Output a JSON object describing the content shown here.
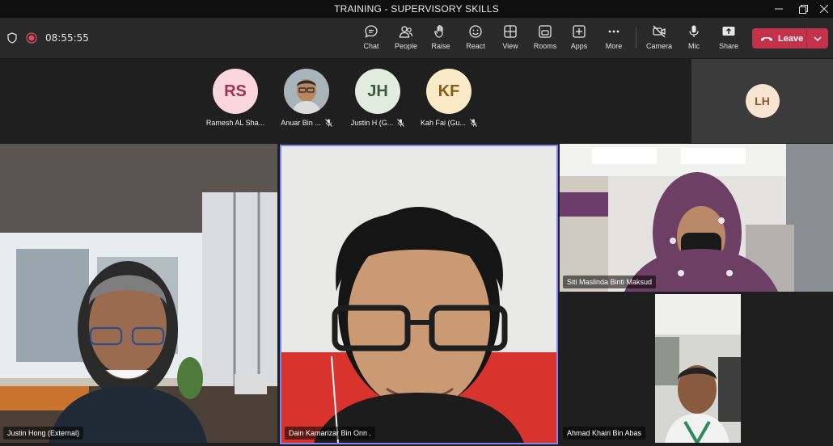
{
  "window": {
    "title": "TRAINING - SUPERVISORY SKILLS"
  },
  "toolbar": {
    "timer": "08:55:55",
    "buttons": [
      {
        "label": "Chat",
        "icon": "chat-icon"
      },
      {
        "label": "People",
        "icon": "people-icon"
      },
      {
        "label": "Raise",
        "icon": "raise-hand-icon"
      },
      {
        "label": "React",
        "icon": "react-icon"
      },
      {
        "label": "View",
        "icon": "view-icon"
      },
      {
        "label": "Rooms",
        "icon": "rooms-icon"
      },
      {
        "label": "Apps",
        "icon": "apps-icon"
      },
      {
        "label": "More",
        "icon": "more-icon"
      },
      {
        "label": "Camera",
        "icon": "camera-off-icon"
      },
      {
        "label": "Mic",
        "icon": "mic-icon"
      },
      {
        "label": "Share",
        "icon": "share-icon"
      }
    ],
    "leave_label": "Leave"
  },
  "strip": {
    "participants": [
      {
        "initials": "RS",
        "name": "Ramesh AL Sha...",
        "bg": "#f9d6dd",
        "fg": "#a0344b",
        "muted": false,
        "photo": false
      },
      {
        "initials": "",
        "name": "Anuar Bin ...",
        "bg": "#8a8a8a",
        "fg": "#ffffff",
        "muted": true,
        "photo": true
      },
      {
        "initials": "JH",
        "name": "Justin H (G...",
        "bg": "#e3ece1",
        "fg": "#3f5a3c",
        "muted": true,
        "photo": false
      },
      {
        "initials": "KF",
        "name": "Kah Fai (Gu...",
        "bg": "#fbeac8",
        "fg": "#8a5a12",
        "muted": true,
        "photo": false
      }
    ],
    "self_initials": "LH"
  },
  "tiles": {
    "justin": "Justin Hong (External)",
    "dain": "Dain Kamarizar Bin Onn .",
    "siti": "Siti Maslinda Binti Maksud",
    "ahmad": "Ahmad Khairi Bin Abas"
  }
}
